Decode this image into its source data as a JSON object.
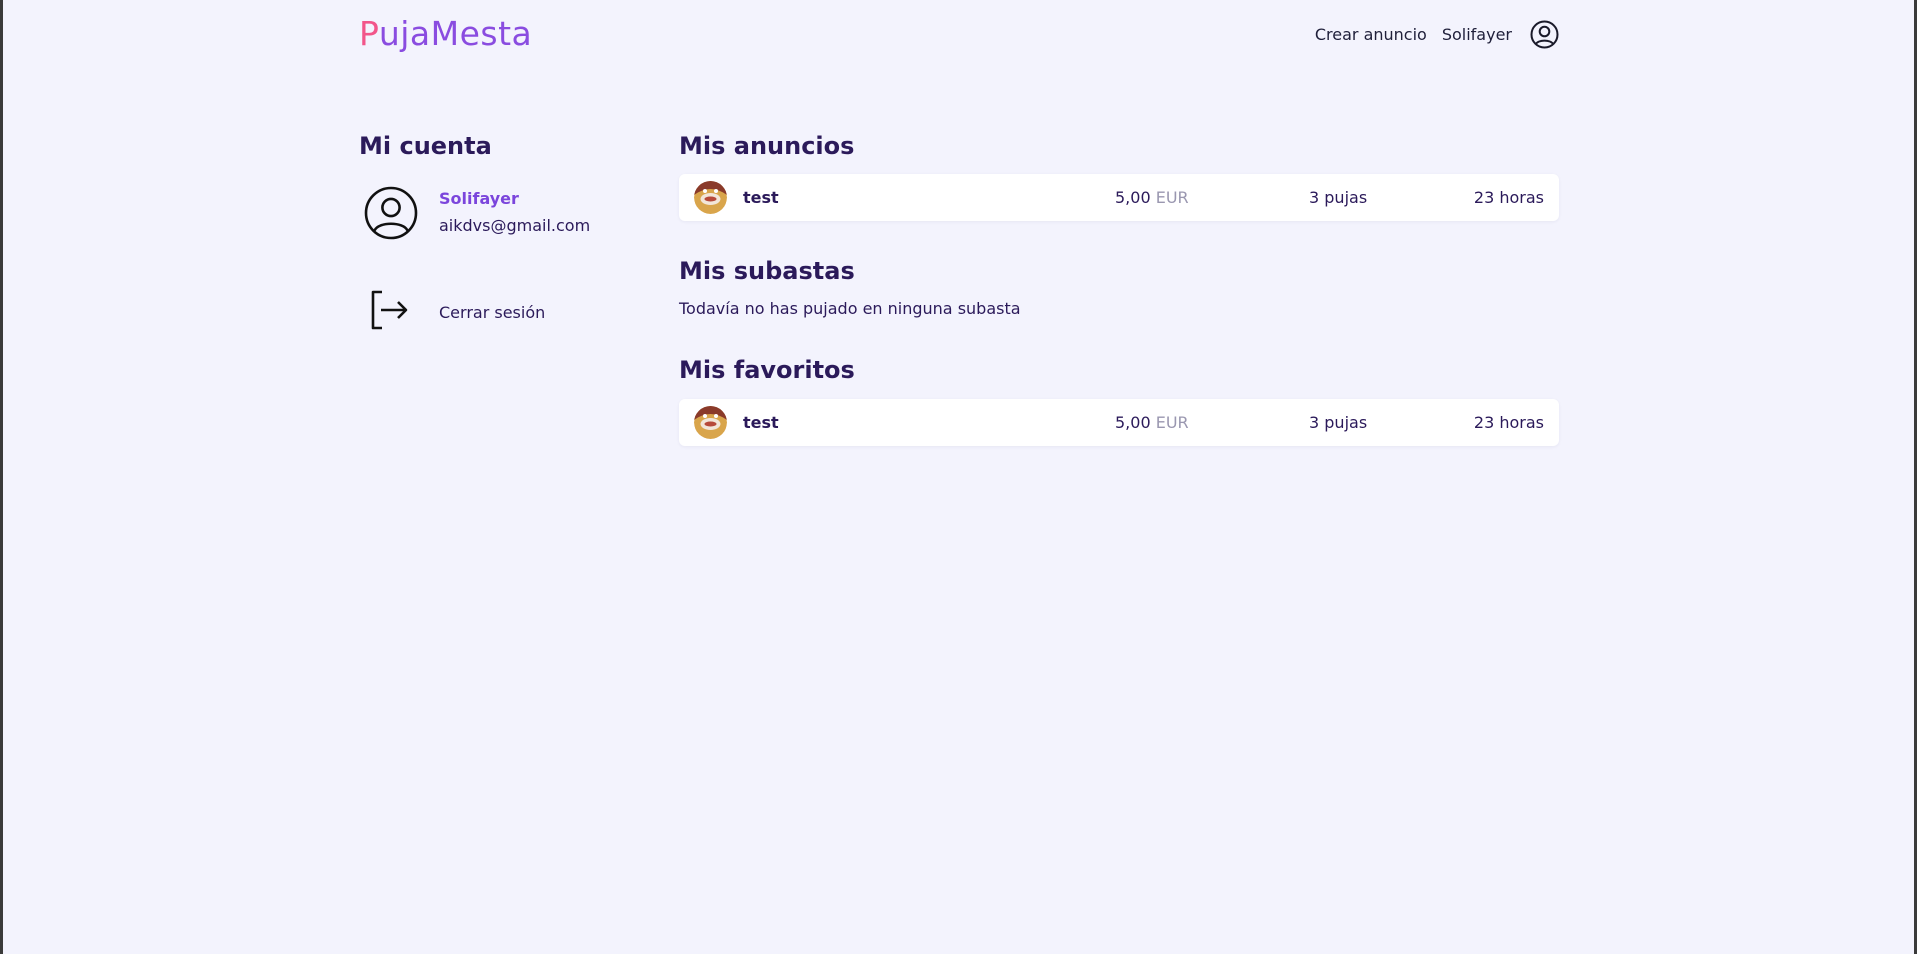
{
  "header": {
    "logo_part1": "P",
    "logo_part2": "ujaMesta",
    "create_ad": "Crear anuncio",
    "username": "Solifayer",
    "user_icon": "user-circle-icon"
  },
  "sidebar": {
    "title": "Mi cuenta",
    "profile": {
      "name": "Solifayer",
      "email": "aikdvs@gmail.com",
      "avatar_icon": "user-circle-icon"
    },
    "logout": {
      "label": "Cerrar sesión",
      "icon": "logout-icon"
    }
  },
  "sections": {
    "ads": {
      "title": "Mis anuncios",
      "items": [
        {
          "title": "test",
          "price": "5,00",
          "currency": "EUR",
          "bids": "3 pujas",
          "time": "23 horas"
        }
      ]
    },
    "auctions": {
      "title": "Mis subastas",
      "empty": "Todavía no has pujado en ninguna subasta"
    },
    "favorites": {
      "title": "Mis favoritos",
      "items": [
        {
          "title": "test",
          "price": "5,00",
          "currency": "EUR",
          "bids": "3 pujas",
          "time": "23 horas"
        }
      ]
    }
  },
  "colors": {
    "background": "#f3f3fd",
    "logo_pink": "#f2558a",
    "logo_purple": "#8a4ce0",
    "accent": "#7b45dc",
    "text": "#2b1a5a"
  }
}
